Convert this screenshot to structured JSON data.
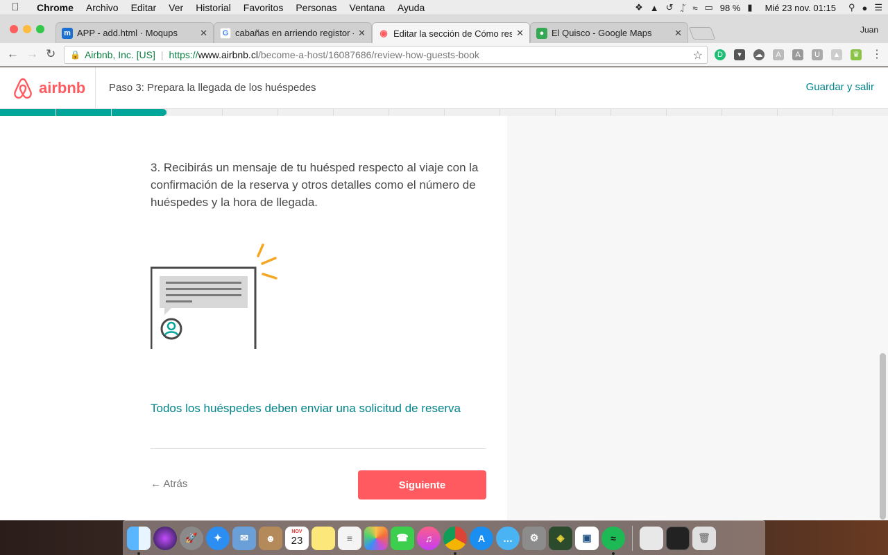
{
  "menubar": {
    "app": "Chrome",
    "items": [
      "Archivo",
      "Editar",
      "Ver",
      "Historial",
      "Favoritos",
      "Personas",
      "Ventana",
      "Ayuda"
    ],
    "battery": "98 %",
    "datetime": "Mié 23 nov.  01:15"
  },
  "browser": {
    "tabs": [
      {
        "title": "APP - add.html · Moqups",
        "icon": "moqups-icon",
        "color": "#1b6fd1"
      },
      {
        "title": "cabañas en arriendo registor -",
        "icon": "google-icon",
        "color": "#ffffff"
      },
      {
        "title": "Editar la sección de Cómo rese",
        "icon": "airbnb-icon",
        "color": "#ff5a5f"
      },
      {
        "title": "El Quisco - Google Maps",
        "icon": "maps-icon",
        "color": "#34a853"
      }
    ],
    "profile": "Juan",
    "url": {
      "org": "Airbnb, Inc. [US]",
      "scheme": "https://",
      "host": "www.airbnb.cl",
      "path": "/become-a-host/16087686/review-how-guests-book"
    }
  },
  "page": {
    "logo_text": "airbnb",
    "step_title": "Paso 3: Prepara la llegada de los huéspedes",
    "save_exit": "Guardar y salir",
    "progress": 0.1875,
    "step_text": "3. Recibirás un mensaje de tu huésped respecto al viaje con la confirmación de la reserva y otros detalles como el número de huéspedes y la hora de llegada.",
    "note_link": "Todos los huéspedes deben enviar una solicitud de reserva",
    "back_label": "Atrás",
    "next_label": "Siguiente",
    "colors": {
      "brand": "#ff5a5f",
      "teal": "#008489",
      "progress": "#00a699",
      "accent": "#f5a623"
    }
  },
  "dock": {
    "calendar_month": "NOV",
    "calendar_day": "23"
  }
}
